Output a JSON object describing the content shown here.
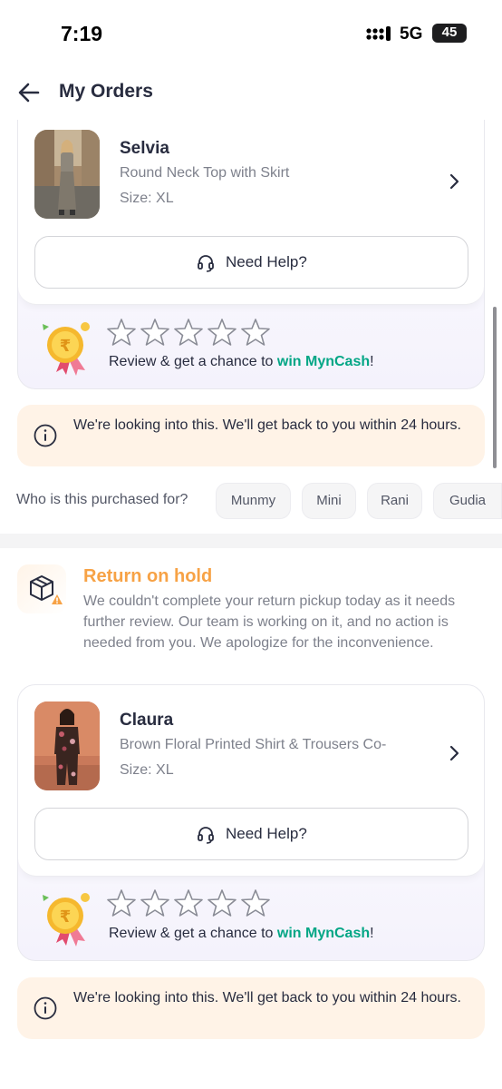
{
  "status_bar": {
    "time": "7:19",
    "network": "5G",
    "battery": "45",
    "battery_level": 0.45
  },
  "header": {
    "title": "My Orders",
    "back_icon": "arrow-left-icon"
  },
  "orders": [
    {
      "brand": "Selvia",
      "product": "Round Neck Top with Skirt",
      "size": "Size: XL",
      "help_label": "Need Help?",
      "rating": 0,
      "max_rating": 5,
      "review_prefix": "Review & get a chance to ",
      "review_highlight": "win MynCash",
      "review_suffix": "!",
      "info_text": "We're looking into this. We'll get back to you within 24 hours."
    },
    {
      "status_title": "Return on hold",
      "status_desc": "We couldn't complete your return pickup today as it needs further review. Our team is working on it, and no action is needed from you. We apologize for the inconvenience.",
      "brand": "Claura",
      "product": "Brown Floral Printed Shirt & Trousers Co-",
      "size": "Size: XL",
      "help_label": "Need Help?",
      "rating": 0,
      "max_rating": 5,
      "review_prefix": "Review & get a chance to ",
      "review_highlight": "win MynCash",
      "review_suffix": "!",
      "info_text": "We're looking into this. We'll get back to you within 24 hours."
    }
  ],
  "purchased_for": {
    "label": "Who is this purchased for?",
    "options": [
      "Munmy",
      "Mini",
      "Rani",
      "Gudia"
    ]
  },
  "colors": {
    "accent_green": "#03a685",
    "warning_orange": "#f7a245",
    "info_bg": "#fff3e7"
  }
}
